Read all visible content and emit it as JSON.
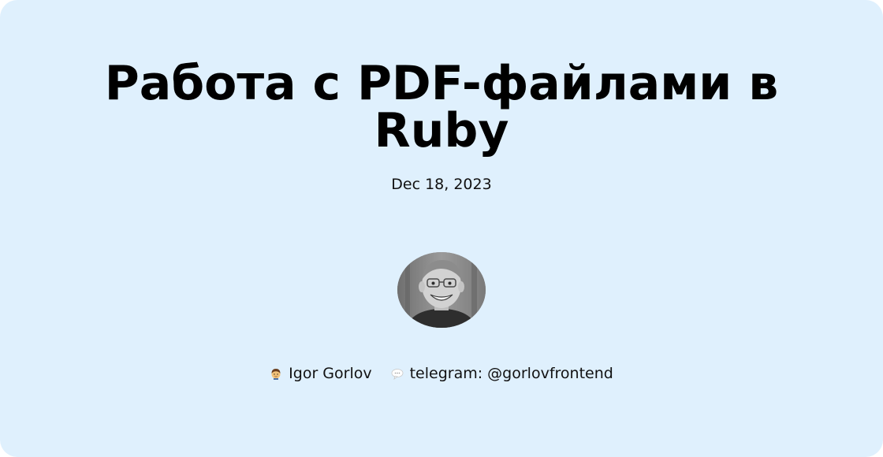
{
  "post": {
    "title": "Работа с PDF-файлами в Ruby",
    "date": "Dec 18, 2023"
  },
  "author": {
    "avatar_icon": "person-photo-avatar",
    "name": "Igor Gorlov",
    "name_icon": "man-emoji-icon",
    "contact": "telegram: @gorlovfrontend",
    "contact_icon": "speech-bubble-icon"
  },
  "colors": {
    "background": "#dff0fd",
    "text": "#000000"
  }
}
